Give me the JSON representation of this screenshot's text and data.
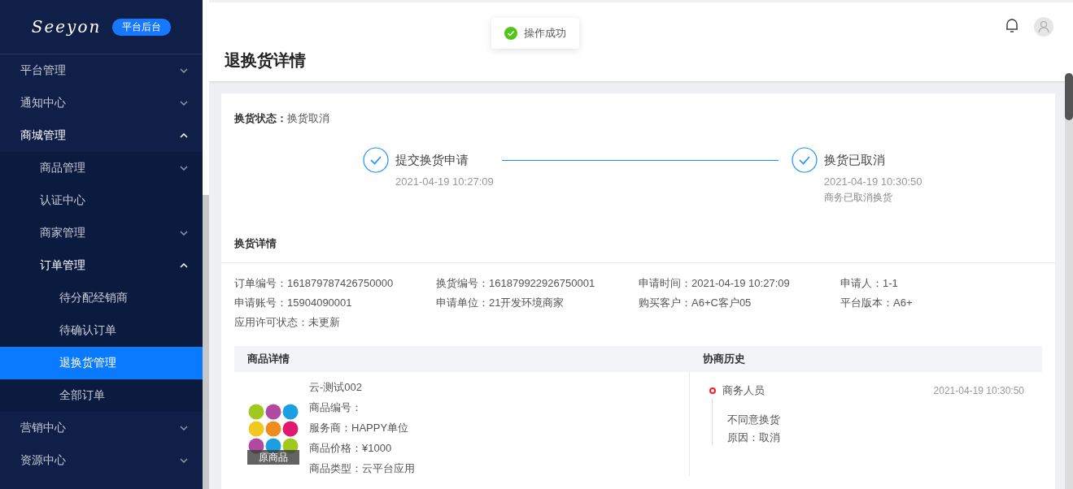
{
  "sidebar": {
    "logo": "Seeyon",
    "badge": "平台后台",
    "items": [
      {
        "label": "平台管理",
        "expanded": false,
        "selected": false
      },
      {
        "label": "通知中心",
        "expanded": false,
        "selected": false
      },
      {
        "label": "商城管理",
        "expanded": true,
        "selected": false,
        "children": [
          {
            "label": "商品管理",
            "expanded": false,
            "selected": false
          },
          {
            "label": "认证中心",
            "selected": false
          },
          {
            "label": "商家管理",
            "expanded": false,
            "selected": false
          },
          {
            "label": "订单管理",
            "expanded": true,
            "selected": false,
            "children": [
              {
                "label": "待分配经销商",
                "selected": false
              },
              {
                "label": "待确认订单",
                "selected": false
              },
              {
                "label": "退换货管理",
                "selected": true
              },
              {
                "label": "全部订单",
                "selected": false
              }
            ]
          }
        ]
      },
      {
        "label": "营销中心",
        "expanded": false,
        "selected": false
      },
      {
        "label": "资源中心",
        "expanded": false,
        "selected": false
      }
    ]
  },
  "toast": {
    "text": "操作成功"
  },
  "page_title": "退换货详情",
  "status": {
    "label": "换货状态：",
    "value": "换货取消"
  },
  "steps": [
    {
      "title": "提交换货申请",
      "time": "2021-04-19 10:27:09"
    },
    {
      "title": "换货已取消",
      "time": "2021-04-19 10:30:50",
      "note": "商务已取消换货"
    }
  ],
  "details": {
    "title": "换货详情",
    "fields": [
      {
        "label": "订单编号：",
        "value": "161879787426750000"
      },
      {
        "label": "换货编号：",
        "value": "161879922926750001"
      },
      {
        "label": "申请时间：",
        "value": "2021-04-19 10:27:09"
      },
      {
        "label": "申请人：",
        "value": "1-1"
      },
      {
        "label": "申请账号：",
        "value": "15904090001"
      },
      {
        "label": "申请单位：",
        "value": "21开发环境商家"
      },
      {
        "label": "购买客户：",
        "value": "A6+C客户05"
      },
      {
        "label": "平台版本：",
        "value": "A6+"
      },
      {
        "label": "应用许可状态：",
        "value": "未更新"
      }
    ]
  },
  "product": {
    "heading": "商品详情",
    "image_tag": "原商品",
    "name": "云-测试002",
    "lines": [
      "商品编号：",
      "服务商：HAPPY单位",
      "商品价格：¥1000",
      "商品类型：云平台应用"
    ]
  },
  "history": {
    "heading": "协商历史",
    "entries": [
      {
        "role": "商务人员",
        "time": "2021-04-19 10:30:50",
        "lines": [
          "不同意换货",
          "原因：取消"
        ]
      }
    ]
  }
}
